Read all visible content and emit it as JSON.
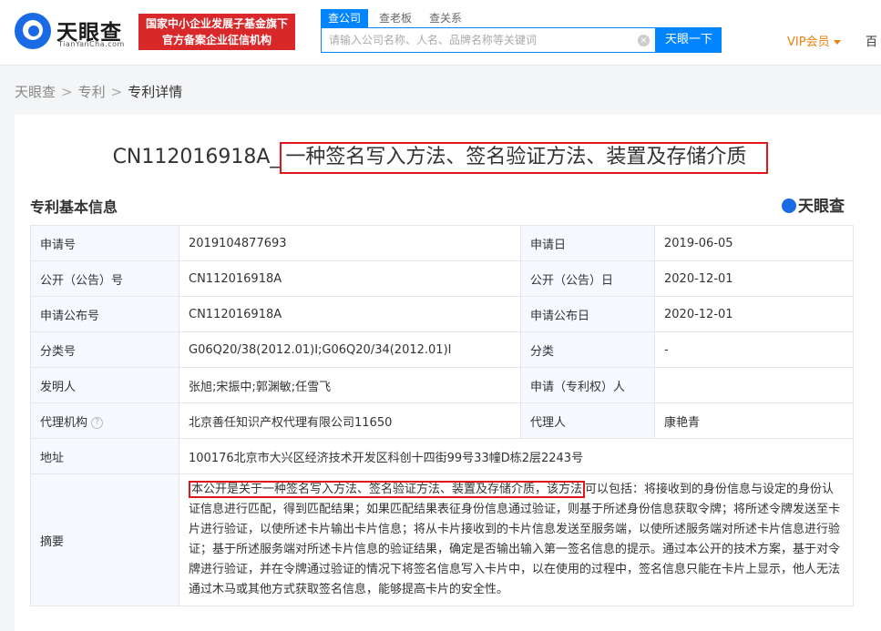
{
  "header": {
    "logo_cn": "天眼查",
    "logo_en": "TianYanCha.com",
    "badge_line1": "国家中小企业发展子基金旗下",
    "badge_line2": "官方备案企业征信机构",
    "tabs": [
      {
        "label": "查公司"
      },
      {
        "label": "查老板"
      },
      {
        "label": "查关系"
      }
    ],
    "search_placeholder": "请输入公司名称、人名、品牌名称等关键词",
    "search_button": "天眼一下",
    "vip_label": "VIP会员",
    "extra_label": "百"
  },
  "breadcrumb": {
    "items": [
      "天眼查",
      "专利",
      "专利详情"
    ]
  },
  "patent": {
    "title_prefix": "CN112016918A_",
    "title_main": "一种签名写入方法、签名验证方法、装置及存储介质",
    "section_heading": "专利基本信息",
    "brand_mark": "天眼查"
  },
  "table": {
    "rows": [
      {
        "l1": "申请号",
        "v1": "2019104877693",
        "l2": "申请日",
        "v2": "2019-06-05"
      },
      {
        "l1": "公开（公告）号",
        "v1": "CN112016918A",
        "l2": "公开（公告）日",
        "v2": "2020-12-01"
      },
      {
        "l1": "申请公布号",
        "v1": "CN112016918A",
        "l2": "申请公布日",
        "v2": "2020-12-01"
      },
      {
        "l1": "分类号",
        "v1": "G06Q20/38(2012.01)I;G06Q20/34(2012.01)I",
        "l2": "分类",
        "v2": "-"
      },
      {
        "l1": "发明人",
        "v1": "张旭;宋振中;郭渊敏;任雪飞",
        "l2": "申请（专利权）人",
        "v2": ""
      },
      {
        "l1": "代理机构",
        "v1": "北京善任知识产权代理有限公司11650",
        "l2": "代理人",
        "v2": "康艳青"
      }
    ],
    "address_label": "地址",
    "address_value": "100176北京市大兴区经济技术开发区科创十四街99号33幢D栋2层2243号",
    "abstract_label": "摘要",
    "abstract_highlight": "本公开是关于一种签名写入方法、签名验证方法、装置及存储介质，该方法",
    "abstract_rest": "可以包括：将接收到的身份信息与设定的身份认证信息进行匹配，得到匹配结果；如果匹配结果表征身份信息通过验证，则基于所述身份信息获取令牌；将所述令牌发送至卡片进行验证，以使所述卡片输出卡片信息；将从卡片接收到的卡片信息发送至服务端，以使所述服务端对所述卡片信息进行验证；基于所述服务端对所述卡片信息的验证结果，确定是否输出输入第一签名信息的提示。通过本公开的技术方案，基于对令牌进行验证，并在令牌通过验证的情况下将签名信息写入卡片中，以在使用的过程中，签名信息只能在卡片上显示，他人无法通过木马或其他方式获取签名信息，能够提高卡片的安全性。"
  }
}
